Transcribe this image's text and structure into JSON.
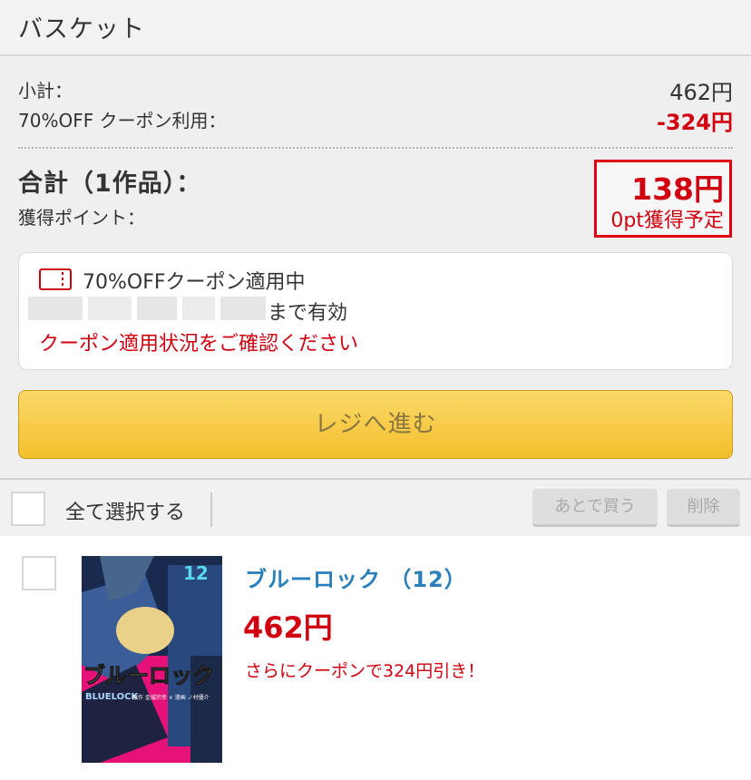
{
  "header": {
    "title": "バスケット"
  },
  "summary": {
    "subtotal_label": "小計：",
    "subtotal_value": "462円",
    "coupon_label": "70%OFF クーポン利用：",
    "coupon_value": "-324円",
    "total_label": "合計（1作品）：",
    "points_label": "獲得ポイント：",
    "total_value": "138円",
    "points_value": "0pt獲得予定"
  },
  "coupon": {
    "title": "70%OFFクーポン適用中",
    "expiry_suffix": "まで有効",
    "note": "クーポン適用状況をご確認ください"
  },
  "checkout": {
    "label": "レジへ進む"
  },
  "bulk": {
    "select_all_label": "全て選択する",
    "later_label": "あとで買う",
    "delete_label": "削除"
  },
  "item": {
    "title": "ブルーロック （12）",
    "price": "462円",
    "promo": "さらにクーポンで324円引き！",
    "cover": {
      "logo": "ブルーロック",
      "volume": "12",
      "subtitle": "BLUELOCK",
      "credits": "原作 金城宗幸 × 漫画 ノ村優介"
    }
  },
  "colors": {
    "accent_red": "#d00010",
    "link_blue": "#2a7fb8",
    "button_yellow": "#f4bf2c"
  }
}
